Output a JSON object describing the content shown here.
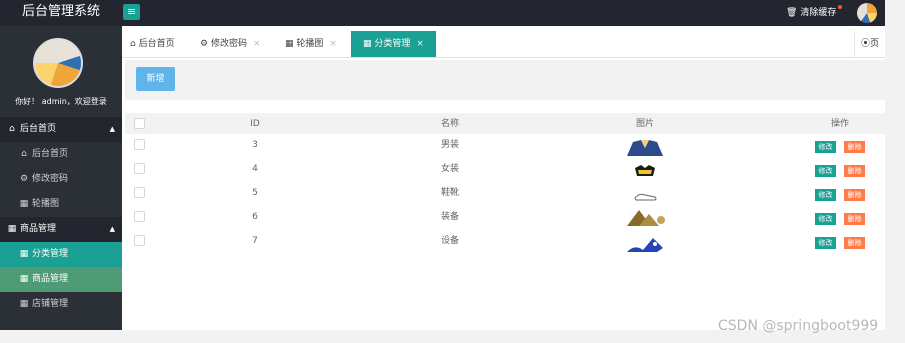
{
  "header": {
    "app_title": "后台管理系统",
    "menu_toggle_icon": "hamburger-icon",
    "clear_cache_label": "清除缓存",
    "cache_icon": "trash-icon"
  },
  "sidebar": {
    "greeting": "你好！ admin，欢迎登录",
    "groups": [
      {
        "label": "后台首页",
        "icon": "home-icon",
        "items": [
          {
            "label": "后台首页",
            "icon": "home-icon"
          },
          {
            "label": "修改密码",
            "icon": "gear-icon"
          },
          {
            "label": "轮播图",
            "icon": "grid-icon"
          }
        ]
      },
      {
        "label": "商品管理",
        "icon": "grid-icon",
        "items": [
          {
            "label": "分类管理",
            "icon": "grid-icon",
            "active": true
          },
          {
            "label": "商品管理",
            "icon": "grid-icon"
          },
          {
            "label": "店铺管理",
            "icon": "grid-icon"
          }
        ]
      }
    ]
  },
  "tabs": [
    {
      "label": "后台首页",
      "icon": "home-icon",
      "closable": false
    },
    {
      "label": "修改密码",
      "icon": "gear-icon",
      "closable": true
    },
    {
      "label": "轮播图",
      "icon": "grid-icon",
      "closable": true
    },
    {
      "label": "分类管理",
      "icon": "grid-icon",
      "closable": true,
      "active": true
    }
  ],
  "tab_close_glyph": "×",
  "tab_right_label": "页",
  "toolbar": {
    "add_label": "新增"
  },
  "table": {
    "columns": [
      "ID",
      "名称",
      "图片",
      "操作"
    ],
    "edit_label": "修改",
    "delete_label": "删除",
    "rows": [
      {
        "id": "3",
        "name": "男装",
        "pic": "suit-image"
      },
      {
        "id": "4",
        "name": "女装",
        "pic": "top-image"
      },
      {
        "id": "5",
        "name": "鞋靴",
        "pic": "shoe-image"
      },
      {
        "id": "6",
        "name": "装备",
        "pic": "tent-image"
      },
      {
        "id": "7",
        "name": "设备",
        "pic": "device-image"
      }
    ]
  },
  "watermark": "CSDN @springboot999",
  "colors": {
    "accent": "#1aa094",
    "dark": "#23262e",
    "sidebar": "#2b2f36",
    "add_button": "#5fb4ea",
    "delete_button": "#ff7b4a"
  }
}
